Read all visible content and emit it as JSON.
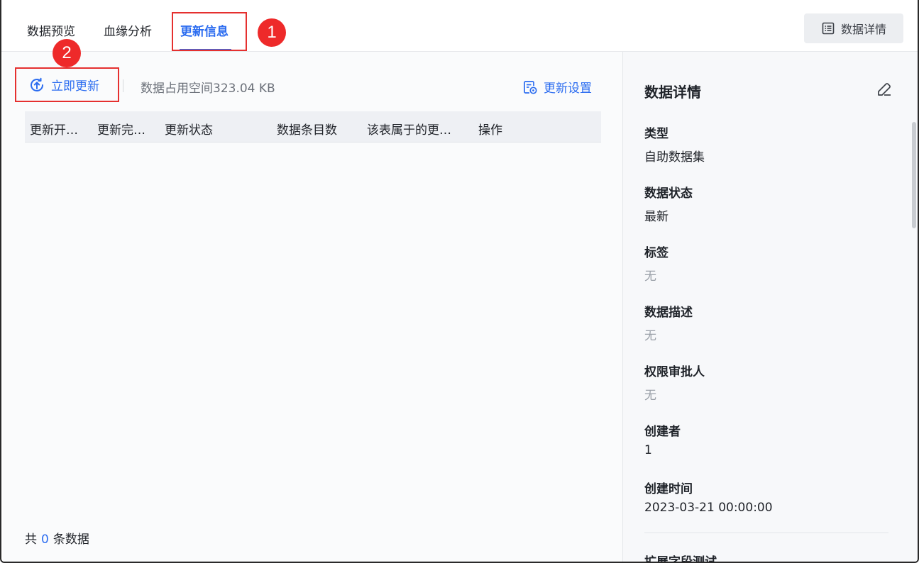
{
  "tabs": [
    {
      "label": "数据预览"
    },
    {
      "label": "血缘分析"
    },
    {
      "label": "更新信息"
    }
  ],
  "annotations": {
    "badge_1": "1",
    "badge_2": "2"
  },
  "header": {
    "detail_button_label": "数据详情"
  },
  "toolbar": {
    "update_now_label": "立即更新",
    "space_text": "数据占用空间323.04 KB",
    "update_settings_label": "更新设置"
  },
  "table": {
    "columns": [
      "更新开…",
      "更新完…",
      "更新状态",
      "数据条目数",
      "该表属于的更…",
      "操作"
    ],
    "rows": []
  },
  "footer": {
    "prefix": "共",
    "count": "0",
    "suffix": "条数据"
  },
  "details": {
    "title": "数据详情",
    "fields": [
      {
        "label": "类型",
        "value": "自助数据集",
        "muted": false
      },
      {
        "label": "数据状态",
        "value": "最新",
        "muted": false
      },
      {
        "label": "标签",
        "value": "无",
        "muted": true
      },
      {
        "label": "数据描述",
        "value": "无",
        "muted": true
      },
      {
        "label": "权限审批人",
        "value": "无",
        "muted": true
      },
      {
        "label": "创建者",
        "value": "1",
        "muted": false
      },
      {
        "label": "创建时间",
        "value": "2023-03-21 00:00:00",
        "muted": false
      }
    ],
    "partial_label": "扩展字段测试"
  },
  "colors": {
    "accent": "#2b6cf0",
    "annotation_red": "#ee2a2a"
  },
  "icons": {
    "update_now": "upload-refresh-icon",
    "update_settings": "settings-doc-icon",
    "detail_button": "list-icon",
    "edit": "edit-pencil-icon"
  }
}
